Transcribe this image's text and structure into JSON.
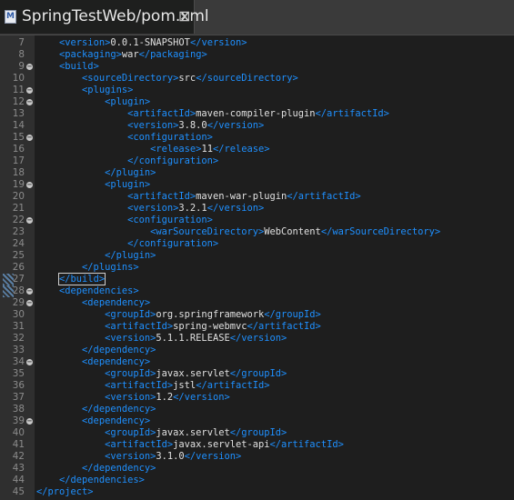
{
  "tab": {
    "title": "SpringTestWeb/pom.xml",
    "close": "⊠",
    "icon": "maven-pom-icon"
  },
  "colors": {
    "tag": "#1e90ff",
    "text": "#e0e0e0",
    "line_number": "#8c8c8c",
    "background": "#1e1e1e"
  },
  "lines": [
    {
      "n": "7",
      "fold": false,
      "indent": "    ",
      "open": "<version>",
      "text": "0.0.1-SNAPSHOT",
      "close": "</version>"
    },
    {
      "n": "8",
      "fold": false,
      "indent": "    ",
      "open": "<packaging>",
      "text": "war",
      "close": "</packaging>"
    },
    {
      "n": "9",
      "fold": true,
      "indent": "    ",
      "open": "<build>",
      "text": "",
      "close": ""
    },
    {
      "n": "10",
      "fold": false,
      "indent": "        ",
      "open": "<sourceDirectory>",
      "text": "src",
      "close": "</sourceDirectory>"
    },
    {
      "n": "11",
      "fold": true,
      "indent": "        ",
      "open": "<plugins>",
      "text": "",
      "close": ""
    },
    {
      "n": "12",
      "fold": true,
      "indent": "            ",
      "open": "<plugin>",
      "text": "",
      "close": ""
    },
    {
      "n": "13",
      "fold": false,
      "indent": "                ",
      "open": "<artifactId>",
      "text": "maven-compiler-plugin",
      "close": "</artifactId>"
    },
    {
      "n": "14",
      "fold": false,
      "indent": "                ",
      "open": "<version>",
      "text": "3.8.0",
      "close": "</version>"
    },
    {
      "n": "15",
      "fold": true,
      "indent": "                ",
      "open": "<configuration>",
      "text": "",
      "close": ""
    },
    {
      "n": "16",
      "fold": false,
      "indent": "                    ",
      "open": "<release>",
      "text": "11",
      "close": "</release>"
    },
    {
      "n": "17",
      "fold": false,
      "indent": "                ",
      "open": "</configuration>",
      "text": "",
      "close": ""
    },
    {
      "n": "18",
      "fold": false,
      "indent": "            ",
      "open": "</plugin>",
      "text": "",
      "close": ""
    },
    {
      "n": "19",
      "fold": true,
      "indent": "            ",
      "open": "<plugin>",
      "text": "",
      "close": ""
    },
    {
      "n": "20",
      "fold": false,
      "indent": "                ",
      "open": "<artifactId>",
      "text": "maven-war-plugin",
      "close": "</artifactId>"
    },
    {
      "n": "21",
      "fold": false,
      "indent": "                ",
      "open": "<version>",
      "text": "3.2.1",
      "close": "</version>"
    },
    {
      "n": "22",
      "fold": true,
      "indent": "                ",
      "open": "<configuration>",
      "text": "",
      "close": ""
    },
    {
      "n": "23",
      "fold": false,
      "indent": "                    ",
      "open": "<warSourceDirectory>",
      "text": "WebContent",
      "close": "</warSourceDirectory>"
    },
    {
      "n": "24",
      "fold": false,
      "indent": "                ",
      "open": "</configuration>",
      "text": "",
      "close": ""
    },
    {
      "n": "25",
      "fold": false,
      "indent": "            ",
      "open": "</plugin>",
      "text": "",
      "close": ""
    },
    {
      "n": "26",
      "fold": false,
      "indent": "        ",
      "open": "</plugins>",
      "text": "",
      "close": ""
    },
    {
      "n": "27",
      "fold": false,
      "indent": "    ",
      "open": "</build>",
      "text": "",
      "close": ""
    },
    {
      "n": "28",
      "fold": true,
      "indent": "    ",
      "open": "<dependencies>",
      "text": "",
      "close": ""
    },
    {
      "n": "29",
      "fold": true,
      "indent": "        ",
      "open": "<dependency>",
      "text": "",
      "close": ""
    },
    {
      "n": "30",
      "fold": false,
      "indent": "            ",
      "open": "<groupId>",
      "text": "org.springframework",
      "close": "</groupId>"
    },
    {
      "n": "31",
      "fold": false,
      "indent": "            ",
      "open": "<artifactId>",
      "text": "spring-webmvc",
      "close": "</artifactId>"
    },
    {
      "n": "32",
      "fold": false,
      "indent": "            ",
      "open": "<version>",
      "text": "5.1.1.RELEASE",
      "close": "</version>"
    },
    {
      "n": "33",
      "fold": false,
      "indent": "        ",
      "open": "</dependency>",
      "text": "",
      "close": ""
    },
    {
      "n": "34",
      "fold": true,
      "indent": "        ",
      "open": "<dependency>",
      "text": "",
      "close": ""
    },
    {
      "n": "35",
      "fold": false,
      "indent": "            ",
      "open": "<groupId>",
      "text": "javax.servlet",
      "close": "</groupId>"
    },
    {
      "n": "36",
      "fold": false,
      "indent": "            ",
      "open": "<artifactId>",
      "text": "jstl",
      "close": "</artifactId>"
    },
    {
      "n": "37",
      "fold": false,
      "indent": "            ",
      "open": "<version>",
      "text": "1.2",
      "close": "</version>"
    },
    {
      "n": "38",
      "fold": false,
      "indent": "        ",
      "open": "</dependency>",
      "text": "",
      "close": ""
    },
    {
      "n": "39",
      "fold": true,
      "indent": "        ",
      "open": "<dependency>",
      "text": "",
      "close": ""
    },
    {
      "n": "40",
      "fold": false,
      "indent": "            ",
      "open": "<groupId>",
      "text": "javax.servlet",
      "close": "</groupId>"
    },
    {
      "n": "41",
      "fold": false,
      "indent": "            ",
      "open": "<artifactId>",
      "text": "javax.servlet-api",
      "close": "</artifactId>"
    },
    {
      "n": "42",
      "fold": false,
      "indent": "            ",
      "open": "<version>",
      "text": "3.1.0",
      "close": "</version>"
    },
    {
      "n": "43",
      "fold": false,
      "indent": "        ",
      "open": "</dependency>",
      "text": "",
      "close": ""
    },
    {
      "n": "44",
      "fold": false,
      "indent": "    ",
      "open": "</dependencies>",
      "text": "",
      "close": ""
    },
    {
      "n": "45",
      "fold": false,
      "indent": "",
      "open": "</project>",
      "text": "",
      "close": ""
    }
  ]
}
